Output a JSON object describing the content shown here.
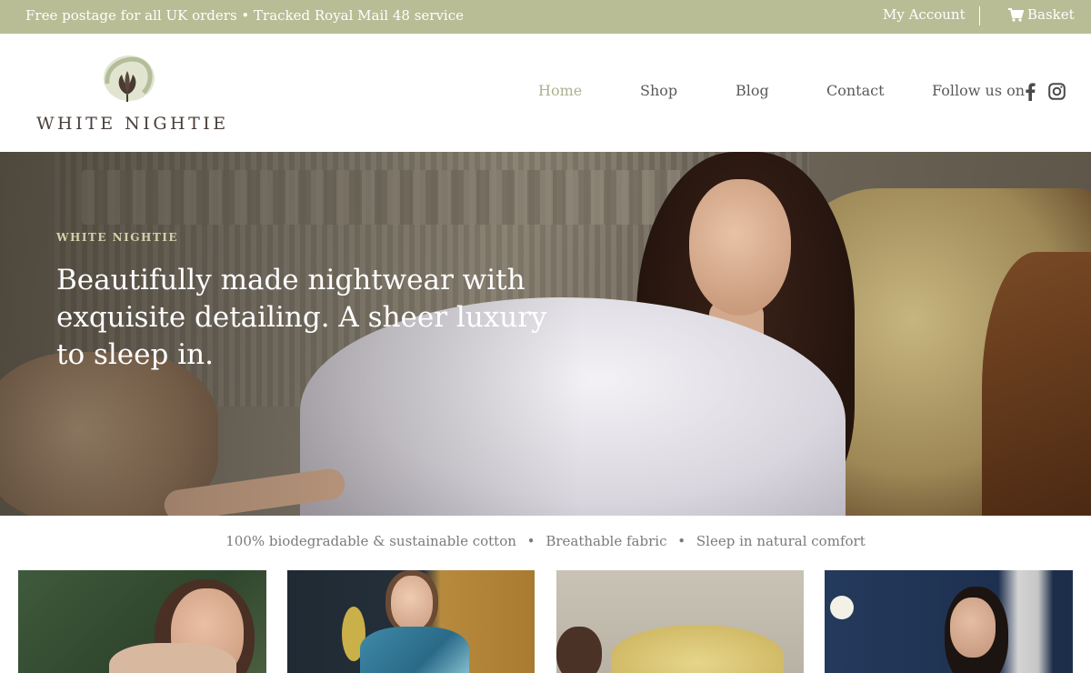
{
  "topbar": {
    "promo": "Free postage for all UK orders • Tracked Royal Mail 48 service",
    "account": "My Account",
    "basket": "Basket"
  },
  "brand": {
    "name": "WHITE NIGHTIE",
    "logo_icon": "cotton-flower-icon"
  },
  "nav": {
    "items": [
      {
        "label": "Home",
        "active": true
      },
      {
        "label": "Shop",
        "active": false
      },
      {
        "label": "Blog",
        "active": false
      },
      {
        "label": "Contact",
        "active": false
      }
    ],
    "follow_label": "Follow us on",
    "social_icons": [
      "facebook-icon",
      "instagram-icon"
    ]
  },
  "hero": {
    "eyebrow": "WHITE NIGHTIE",
    "headline": "Beautifully made nightwear with exquisite detailing. A sheer luxury to sleep in."
  },
  "features": {
    "items": [
      "100% biodegradable & sustainable cotton",
      "Breathable fabric",
      "Sleep in natural comfort"
    ],
    "separator": "•"
  },
  "colors": {
    "accent": "#b8bd95",
    "nav_active": "#a9b38c",
    "text": "#5a5a5a"
  }
}
